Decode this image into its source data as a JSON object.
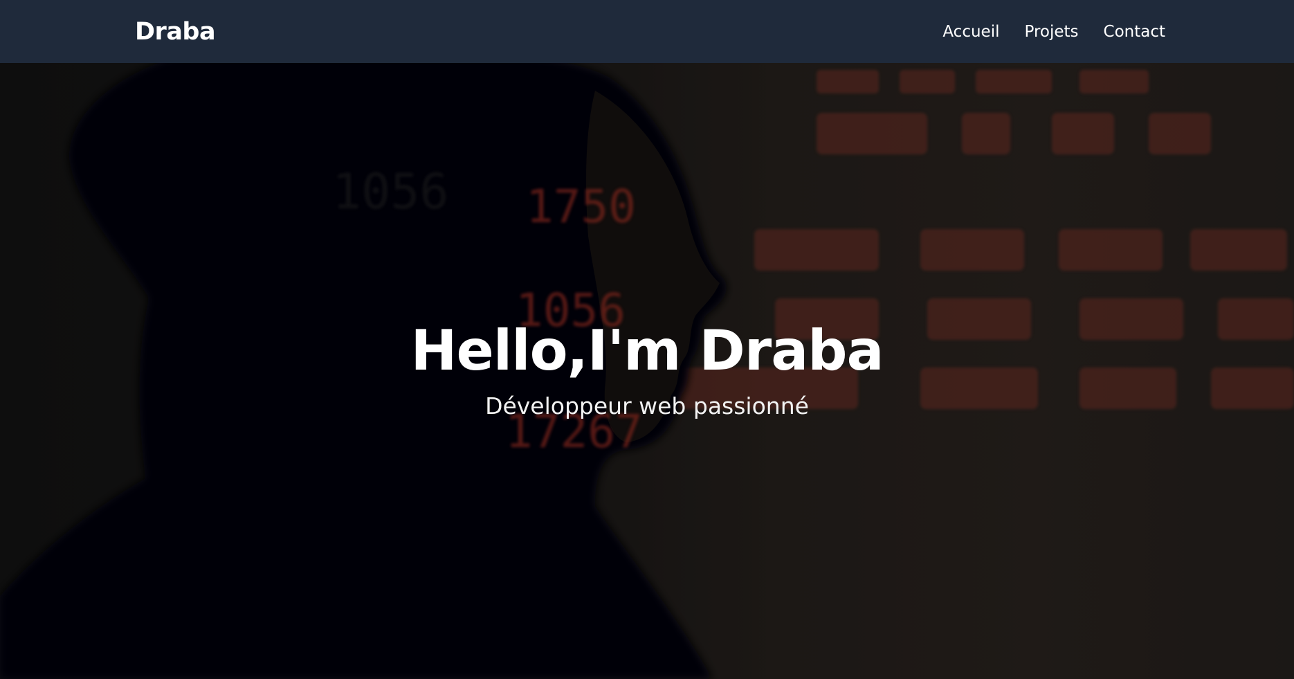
{
  "navbar": {
    "brand": "Draba",
    "links": [
      {
        "label": "Accueil"
      },
      {
        "label": "Projets"
      },
      {
        "label": "Contact"
      }
    ]
  },
  "hero": {
    "title": "Hello,I'm Draba",
    "subtitle": "Développeur web passionné",
    "background_image": "hooded-figure-with-projected-red-code",
    "code_glyph_color": "#c0392b"
  },
  "colors": {
    "navbar_bg": "#1f2a3b",
    "text": "#ffffff"
  }
}
